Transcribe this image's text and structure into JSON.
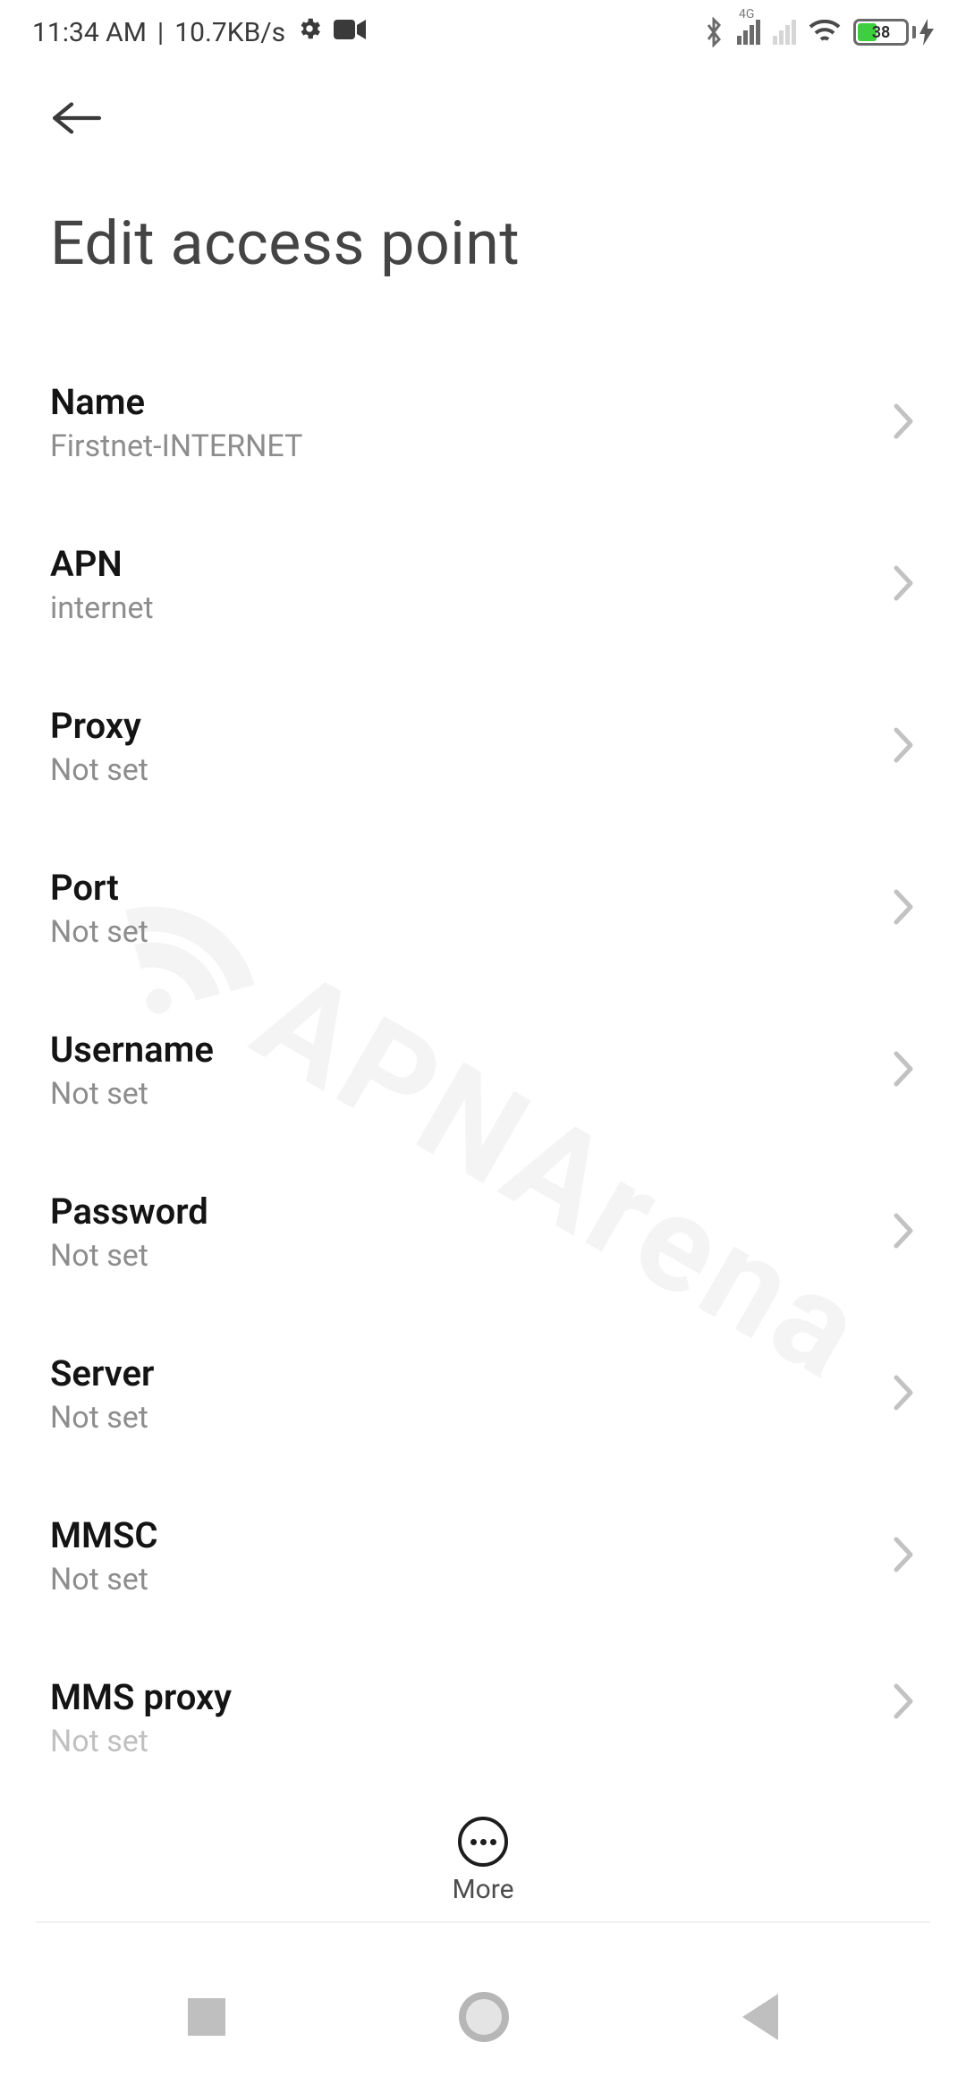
{
  "status": {
    "time": "11:34 AM",
    "separator": "|",
    "net_speed": "10.7KB/s",
    "icons_left": [
      "settings-gear-icon",
      "camera-icon"
    ],
    "network_badge": "4G",
    "battery": "38"
  },
  "header": {
    "back_label": "Back"
  },
  "page": {
    "title": "Edit access point"
  },
  "fields": [
    {
      "label": "Name",
      "value": "Firstnet-INTERNET"
    },
    {
      "label": "APN",
      "value": "internet"
    },
    {
      "label": "Proxy",
      "value": "Not set"
    },
    {
      "label": "Port",
      "value": "Not set"
    },
    {
      "label": "Username",
      "value": "Not set"
    },
    {
      "label": "Password",
      "value": "Not set"
    },
    {
      "label": "Server",
      "value": "Not set"
    },
    {
      "label": "MMSC",
      "value": "Not set"
    },
    {
      "label": "MMS proxy",
      "value": "Not set"
    }
  ],
  "footer": {
    "more_label": "More"
  },
  "watermark": "APNArena"
}
